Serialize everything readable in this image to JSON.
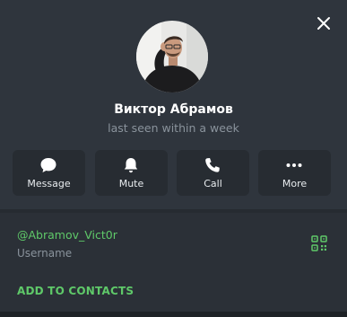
{
  "profile": {
    "name": "Виктор Абрамов",
    "status": "last seen within a week"
  },
  "actions": {
    "message_label": "Message",
    "mute_label": "Mute",
    "call_label": "Call",
    "more_label": "More"
  },
  "info": {
    "username": "@Abramov_Vict0r",
    "username_label": "Username",
    "add_to_contacts": "ADD TO CONTACTS"
  },
  "icons": {
    "close": "close-icon",
    "message": "chat-bubble-icon",
    "mute": "bell-icon",
    "call": "phone-icon",
    "more": "more-dots-icon",
    "qr": "qr-code-icon"
  },
  "colors": {
    "background": "#2f353d",
    "accent": "#5fc969",
    "text": "#ffffff",
    "muted": "#8a939c",
    "button": "#272c32"
  }
}
